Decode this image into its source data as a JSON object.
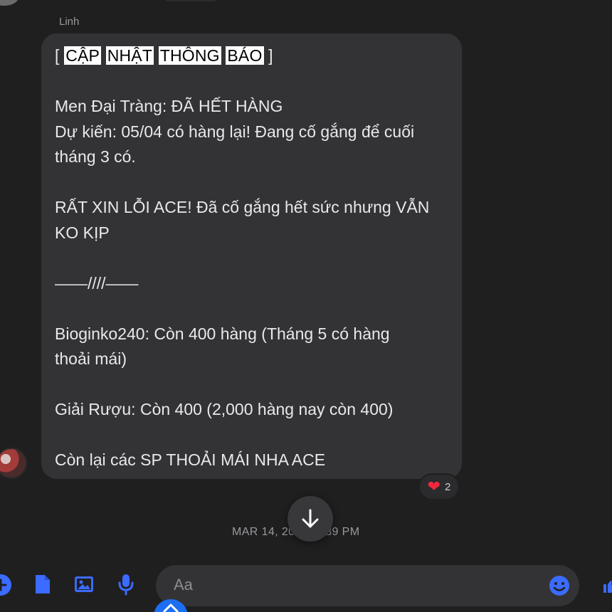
{
  "chat": {
    "sender_name": "Linh",
    "message": {
      "lines": [
        {
          "type": "heading",
          "open": "[",
          "highlights": [
            "CẬP",
            "NHẬT",
            "THÔNG",
            "BÁO"
          ],
          "close": "]"
        },
        {
          "type": "empty"
        },
        {
          "type": "text",
          "text": "Men Đại Tràng: ĐÃ HẾT HÀNG"
        },
        {
          "type": "text",
          "text": "Dự kiến: 05/04 có hàng lại! Đang cố gắng để cuối"
        },
        {
          "type": "text",
          "text": "tháng 3 có."
        },
        {
          "type": "empty"
        },
        {
          "type": "text",
          "text": "RẤT XIN LỖI ACE! Đã cố gắng hết sức nhưng VẪN"
        },
        {
          "type": "text",
          "text": "KO KỊP"
        },
        {
          "type": "empty"
        },
        {
          "type": "text",
          "text": "——////——"
        },
        {
          "type": "empty"
        },
        {
          "type": "text",
          "text": "Bioginko240: Còn 400 hàng (Tháng 5 có hàng"
        },
        {
          "type": "text",
          "text": "thoải mái)"
        },
        {
          "type": "empty"
        },
        {
          "type": "text",
          "text": "Giải Rượu: Còn 400 (2,000 hàng nay còn 400)"
        },
        {
          "type": "empty"
        },
        {
          "type": "text",
          "text": "Còn lại các SP THOẢI MÁI NHA ACE"
        }
      ]
    },
    "reaction": {
      "icon": "heart-icon",
      "count": "2"
    },
    "timestamp": "MAR 14, 20     AT 8:39 PM"
  },
  "composer": {
    "placeholder": "Aa",
    "tools": [
      "plus-icon",
      "file-icon",
      "image-icon",
      "microphone-icon"
    ],
    "emoji_icon": "smiley-icon"
  },
  "colors": {
    "background": "#1f1f20",
    "bubble": "#333335",
    "accent": "#3b6bff",
    "heart": "#f0283c"
  }
}
